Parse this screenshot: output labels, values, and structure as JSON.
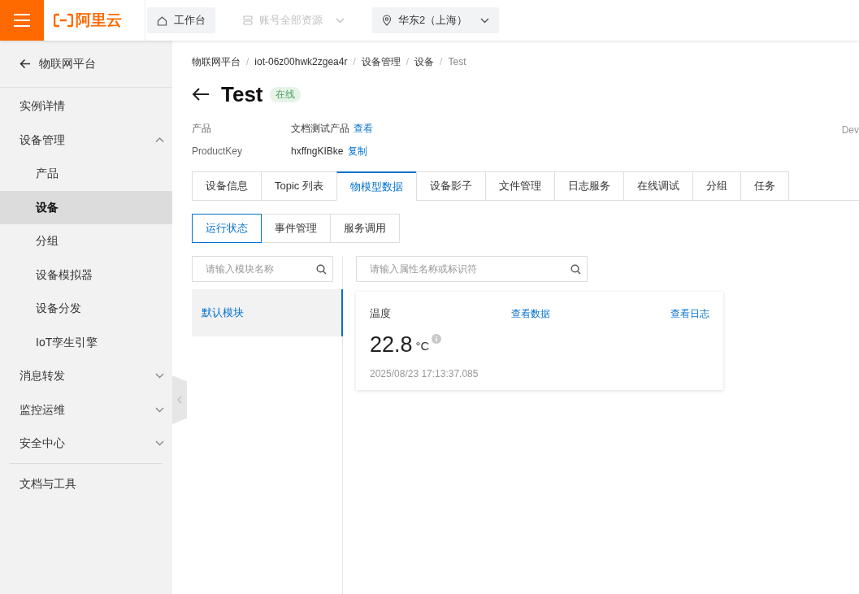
{
  "topbar": {
    "logo_text": "阿里云",
    "nav": [
      {
        "kind": "button",
        "label": "工作台",
        "disabled": false
      },
      {
        "kind": "dropdown",
        "label": "账号全部资源",
        "disabled": true
      },
      {
        "kind": "region",
        "label": "华东2（上海）",
        "disabled": false
      }
    ]
  },
  "sidebar": {
    "back_label": "物联网平台",
    "items": [
      {
        "label": "实例详情",
        "selected": false
      },
      {
        "label": "设备管理",
        "selected": false,
        "expanded": true,
        "children": [
          {
            "label": "产品",
            "selected": false
          },
          {
            "label": "设备",
            "selected": true
          },
          {
            "label": "分组",
            "selected": false
          },
          {
            "label": "设备模拟器",
            "selected": false
          },
          {
            "label": "设备分发",
            "selected": false
          },
          {
            "label": "IoT孪生引擎",
            "selected": false
          }
        ]
      },
      {
        "label": "消息转发",
        "selected": false,
        "expanded": false
      },
      {
        "label": "监控运维",
        "selected": false,
        "expanded": false
      },
      {
        "label": "安全中心",
        "selected": false,
        "expanded": false
      }
    ],
    "footer_items": [
      "文档与工具"
    ]
  },
  "breadcrumb": {
    "separator": "/",
    "items": [
      "物联网平台",
      "iot-06z00hwk2zgea4r",
      "设备管理",
      "设备",
      "Test"
    ]
  },
  "device": {
    "title": "Test",
    "status": "在线",
    "info": [
      {
        "label": "产品",
        "value": "文档测试产品",
        "link": "查看"
      },
      {
        "label": "ProductKey",
        "value": "hxffngKIBke",
        "link": "复制"
      }
    ],
    "info_right_label": "Dev"
  },
  "tabs": [
    {
      "label": "设备信息",
      "selected": false
    },
    {
      "label": "Topic 列表",
      "selected": false
    },
    {
      "label": "物模型数据",
      "selected": true
    },
    {
      "label": "设备影子",
      "selected": false
    },
    {
      "label": "文件管理",
      "selected": false
    },
    {
      "label": "日志服务",
      "selected": false
    },
    {
      "label": "在线调试",
      "selected": false
    },
    {
      "label": "分组",
      "selected": false
    },
    {
      "label": "任务",
      "selected": false
    }
  ],
  "subtabs": [
    {
      "label": "运行状态",
      "selected": true
    },
    {
      "label": "事件管理",
      "selected": false
    },
    {
      "label": "服务调用",
      "selected": false
    }
  ],
  "module_search": {
    "placeholder": "请输入模块名称"
  },
  "modules": [
    {
      "label": "默认模块",
      "selected": true
    }
  ],
  "property_search": {
    "placeholder": "请输入属性名称或标识符"
  },
  "properties": [
    {
      "name": "温度",
      "data_link": "查看数据",
      "log_link": "查看日志",
      "value": "22.8",
      "unit": "°C",
      "time": "2025/08/23 17:13:37.085"
    }
  ]
}
